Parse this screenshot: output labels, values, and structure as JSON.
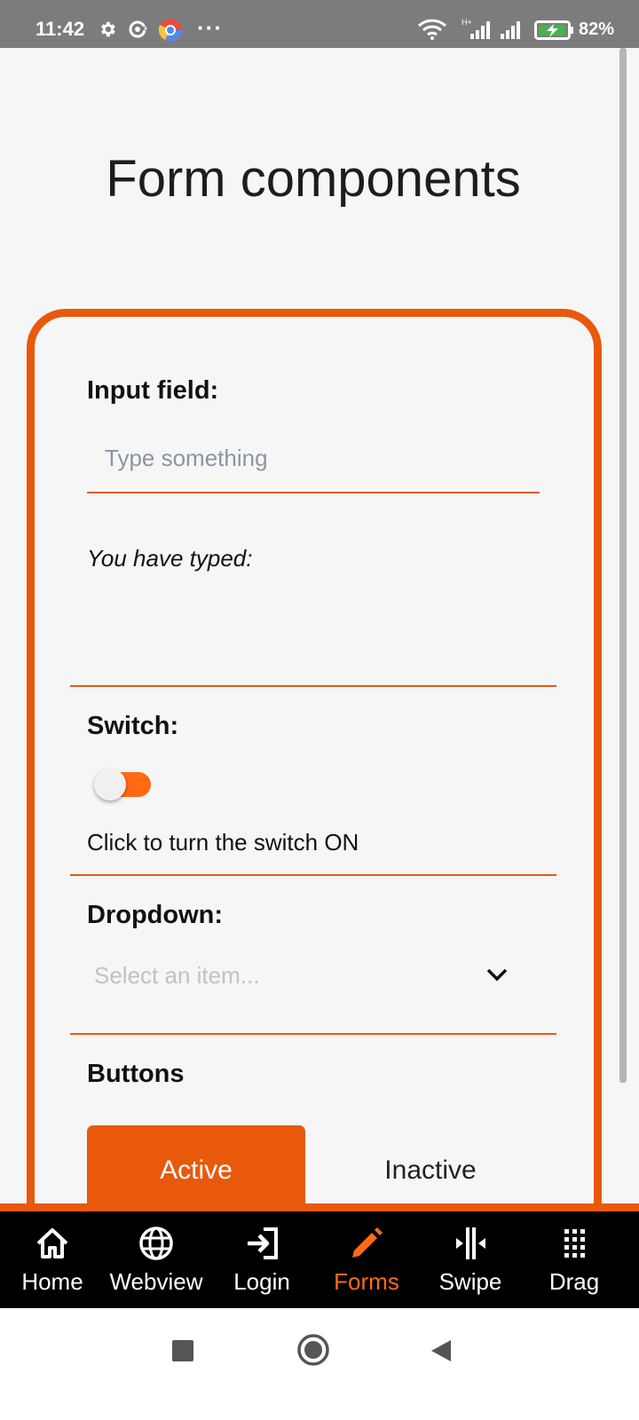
{
  "status_bar": {
    "time": "11:42",
    "battery_percent": "82%",
    "overflow": "···",
    "icons": [
      "gear-icon",
      "sync-icon",
      "chrome-icon",
      "wifi-icon",
      "signal-icon",
      "battery-charging-icon"
    ]
  },
  "page": {
    "title": "Form components"
  },
  "form": {
    "input_label": "Input field:",
    "input_placeholder": "Type something",
    "input_value": "",
    "typed_label": "You have typed:",
    "switch_label": "Switch:",
    "switch_state": "off",
    "switch_hint": "Click to turn the switch ON",
    "dropdown_label": "Dropdown:",
    "dropdown_placeholder": "Select an item...",
    "buttons_label": "Buttons",
    "button_active": "Active",
    "button_inactive": "Inactive"
  },
  "tabs": [
    {
      "label": "Home",
      "icon": "home-icon",
      "active": false
    },
    {
      "label": "Webview",
      "icon": "globe-icon",
      "active": false
    },
    {
      "label": "Login",
      "icon": "login-icon",
      "active": false
    },
    {
      "label": "Forms",
      "icon": "pencil-icon",
      "active": true
    },
    {
      "label": "Swipe",
      "icon": "swipe-icon",
      "active": false
    },
    {
      "label": "Drag",
      "icon": "grid-icon",
      "active": false
    }
  ],
  "colors": {
    "accent": "#e8590c",
    "status_bar": "#7c7c7c",
    "tab_bar": "#000000"
  }
}
